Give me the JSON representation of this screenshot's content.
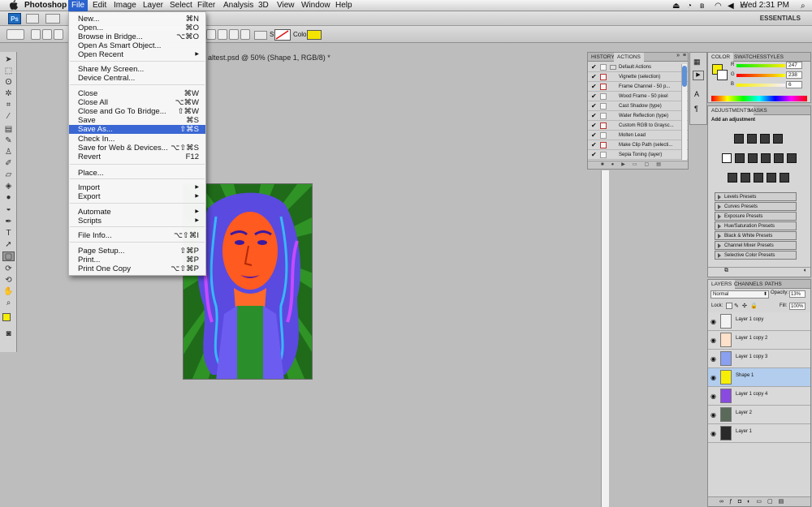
{
  "menubar": {
    "app": "Photoshop",
    "items": [
      "File",
      "Edit",
      "Image",
      "Layer",
      "Select",
      "Filter",
      "Analysis",
      "3D",
      "View",
      "Window",
      "Help"
    ],
    "clock": "Wed 2:31 PM"
  },
  "appbar": {
    "ps_badge": "Ps",
    "workspace": "ESSENTIALS"
  },
  "options": {
    "style_label": "Style:",
    "color_label": "Color:",
    "color": "#f2e400"
  },
  "document": {
    "tab_title": "altest.psd @ 50% (Shape 1, RGB/8) *"
  },
  "file_menu": {
    "items": [
      {
        "label": "New...",
        "shortcut": "⌘N",
        "submenu": false
      },
      {
        "label": "Open...",
        "shortcut": "⌘O",
        "submenu": false
      },
      {
        "label": "Browse in Bridge...",
        "shortcut": "⌥⌘O",
        "submenu": false
      },
      {
        "label": "Open As Smart Object...",
        "shortcut": "",
        "submenu": false
      },
      {
        "label": "Open Recent",
        "shortcut": "",
        "submenu": true
      },
      {
        "label": "Share My Screen...",
        "shortcut": "",
        "submenu": false
      },
      {
        "label": "Device Central...",
        "shortcut": "",
        "submenu": false
      },
      {
        "label": "Close",
        "shortcut": "⌘W",
        "submenu": false
      },
      {
        "label": "Close All",
        "shortcut": "⌥⌘W",
        "submenu": false
      },
      {
        "label": "Close and Go To Bridge...",
        "shortcut": "⇧⌘W",
        "submenu": false
      },
      {
        "label": "Save",
        "shortcut": "⌘S",
        "submenu": false
      },
      {
        "label": "Save As...",
        "shortcut": "⇧⌘S",
        "submenu": false,
        "selected": true
      },
      {
        "label": "Check In...",
        "shortcut": "",
        "submenu": false
      },
      {
        "label": "Save for Web & Devices...",
        "shortcut": "⌥⇧⌘S",
        "submenu": false
      },
      {
        "label": "Revert",
        "shortcut": "F12",
        "submenu": false
      },
      {
        "label": "Place...",
        "shortcut": "",
        "submenu": false
      },
      {
        "label": "Import",
        "shortcut": "",
        "submenu": true
      },
      {
        "label": "Export",
        "shortcut": "",
        "submenu": true
      },
      {
        "label": "Automate",
        "shortcut": "",
        "submenu": true
      },
      {
        "label": "Scripts",
        "shortcut": "",
        "submenu": true
      },
      {
        "label": "File Info...",
        "shortcut": "⌥⇧⌘I",
        "submenu": false
      },
      {
        "label": "Page Setup...",
        "shortcut": "⇧⌘P",
        "submenu": false
      },
      {
        "label": "Print...",
        "shortcut": "⌘P",
        "submenu": false
      },
      {
        "label": "Print One Copy",
        "shortcut": "⌥⇧⌘P",
        "submenu": false
      }
    ]
  },
  "history_panel": {
    "tabs": [
      "HISTORY",
      "ACTIONS"
    ],
    "actions": [
      "Default Actions",
      "Vignette (selection)",
      "Frame Channel - 50 p...",
      "Wood Frame - 50 pixel",
      "Cast Shadow (type)",
      "Water Reflection (type)",
      "Custom RGB to Graysc...",
      "Molten Lead",
      "Make Clip Path (selecti...",
      "Sepia Toning (layer)"
    ]
  },
  "color_panel": {
    "tabs": [
      "COLOR",
      "SWATCHES",
      "STYLES"
    ],
    "channels": [
      {
        "label": "R",
        "value": "247"
      },
      {
        "label": "G",
        "value": "238"
      },
      {
        "label": "B",
        "value": "6"
      }
    ],
    "foreground": "#f7ee06"
  },
  "adjustments_panel": {
    "tabs": [
      "ADJUSTMENTS",
      "MASKS"
    ],
    "heading": "Add an adjustment",
    "presets": [
      "Levels Presets",
      "Curves Presets",
      "Exposure Presets",
      "Hue/Saturation Presets",
      "Black & White Presets",
      "Channel Mixer Presets",
      "Selective Color Presets"
    ]
  },
  "layers_panel": {
    "tabs": [
      "LAYERS",
      "CHANNELS",
      "PATHS"
    ],
    "blend_mode": "Normal",
    "opacity_label": "Opacity:",
    "opacity": "13%",
    "lock_label": "Lock:",
    "fill_label": "Fill:",
    "fill": "100%",
    "layers": [
      {
        "name": "Layer 1 copy",
        "selected": false
      },
      {
        "name": "Layer 1 copy 2",
        "selected": false
      },
      {
        "name": "Layer 1 copy 3",
        "selected": false
      },
      {
        "name": "Shape 1",
        "selected": true
      },
      {
        "name": "Layer 1 copy 4",
        "selected": false
      },
      {
        "name": "Layer 2",
        "selected": false
      },
      {
        "name": "Layer 1",
        "selected": false
      }
    ]
  }
}
